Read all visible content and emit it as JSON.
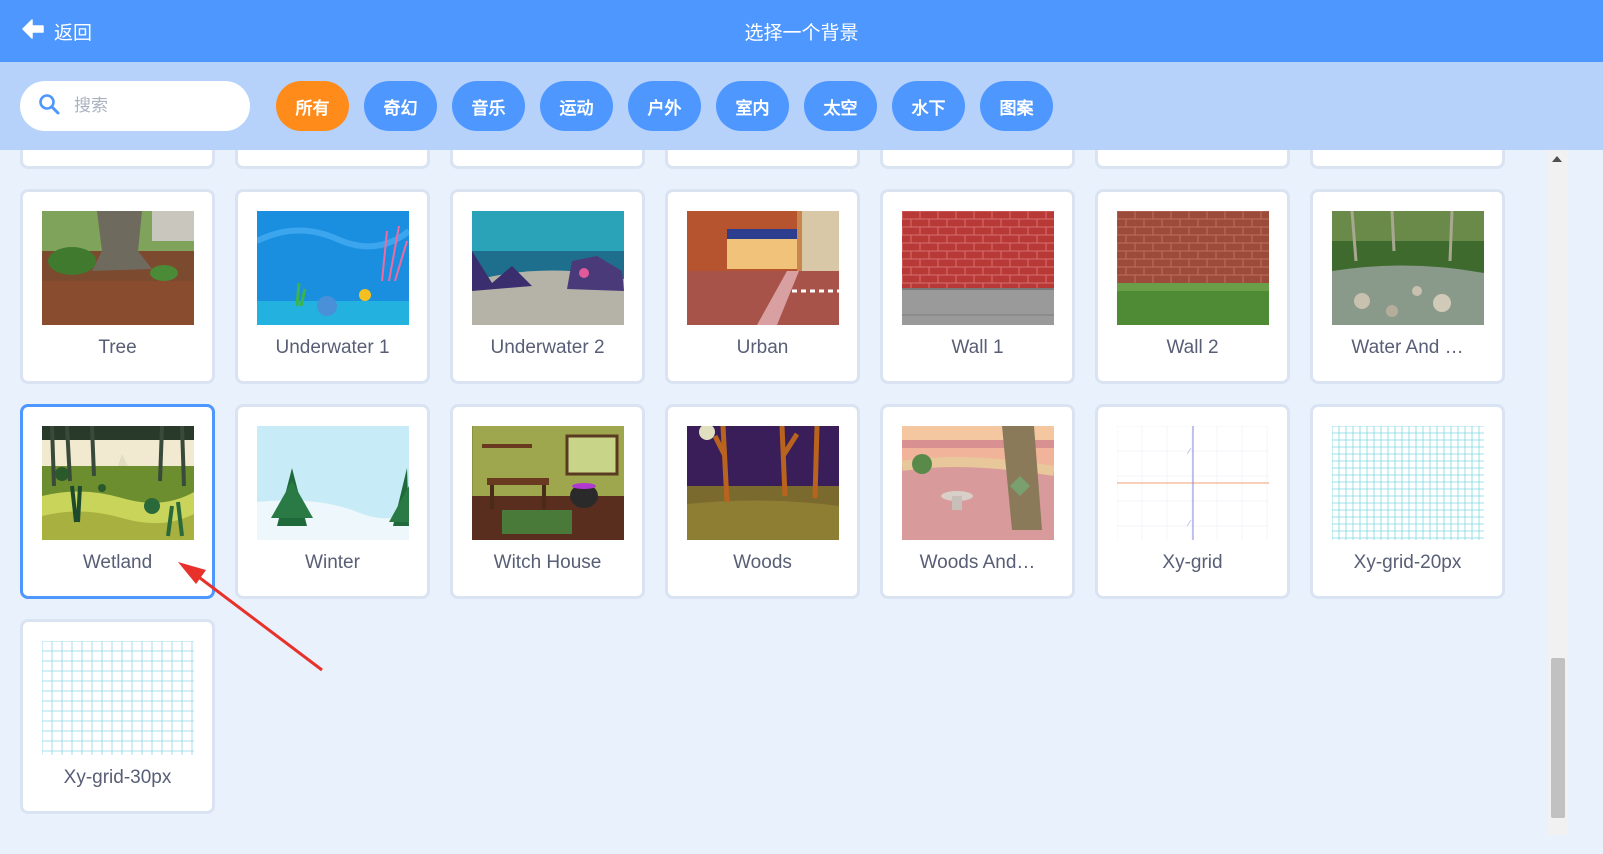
{
  "header": {
    "back_label": "返回",
    "title": "选择一个背景"
  },
  "search": {
    "placeholder": "搜索",
    "value": ""
  },
  "tags": [
    {
      "label": "所有",
      "active": true
    },
    {
      "label": "奇幻",
      "active": false
    },
    {
      "label": "音乐",
      "active": false
    },
    {
      "label": "运动",
      "active": false
    },
    {
      "label": "户外",
      "active": false
    },
    {
      "label": "室内",
      "active": false
    },
    {
      "label": "太空",
      "active": false
    },
    {
      "label": "水下",
      "active": false
    },
    {
      "label": "图案",
      "active": false
    }
  ],
  "backdrops": [
    {
      "name": "Tree"
    },
    {
      "name": "Underwater 1"
    },
    {
      "name": "Underwater 2"
    },
    {
      "name": "Urban"
    },
    {
      "name": "Wall 1"
    },
    {
      "name": "Wall 2"
    },
    {
      "name": "Water And …"
    },
    {
      "name": "Wetland",
      "selected": true
    },
    {
      "name": "Winter"
    },
    {
      "name": "Witch House"
    },
    {
      "name": "Woods"
    },
    {
      "name": "Woods And…"
    },
    {
      "name": "Xy-grid"
    },
    {
      "name": "Xy-grid-20px"
    },
    {
      "name": "Xy-grid-30px"
    }
  ],
  "colors": {
    "header": "#4d97ff",
    "filter_bar": "#b6d2fb",
    "active_tag": "#ff8c1a",
    "tag": "#4d97ff",
    "selected_border": "#4d97ff",
    "arrow": "#e8312a"
  }
}
